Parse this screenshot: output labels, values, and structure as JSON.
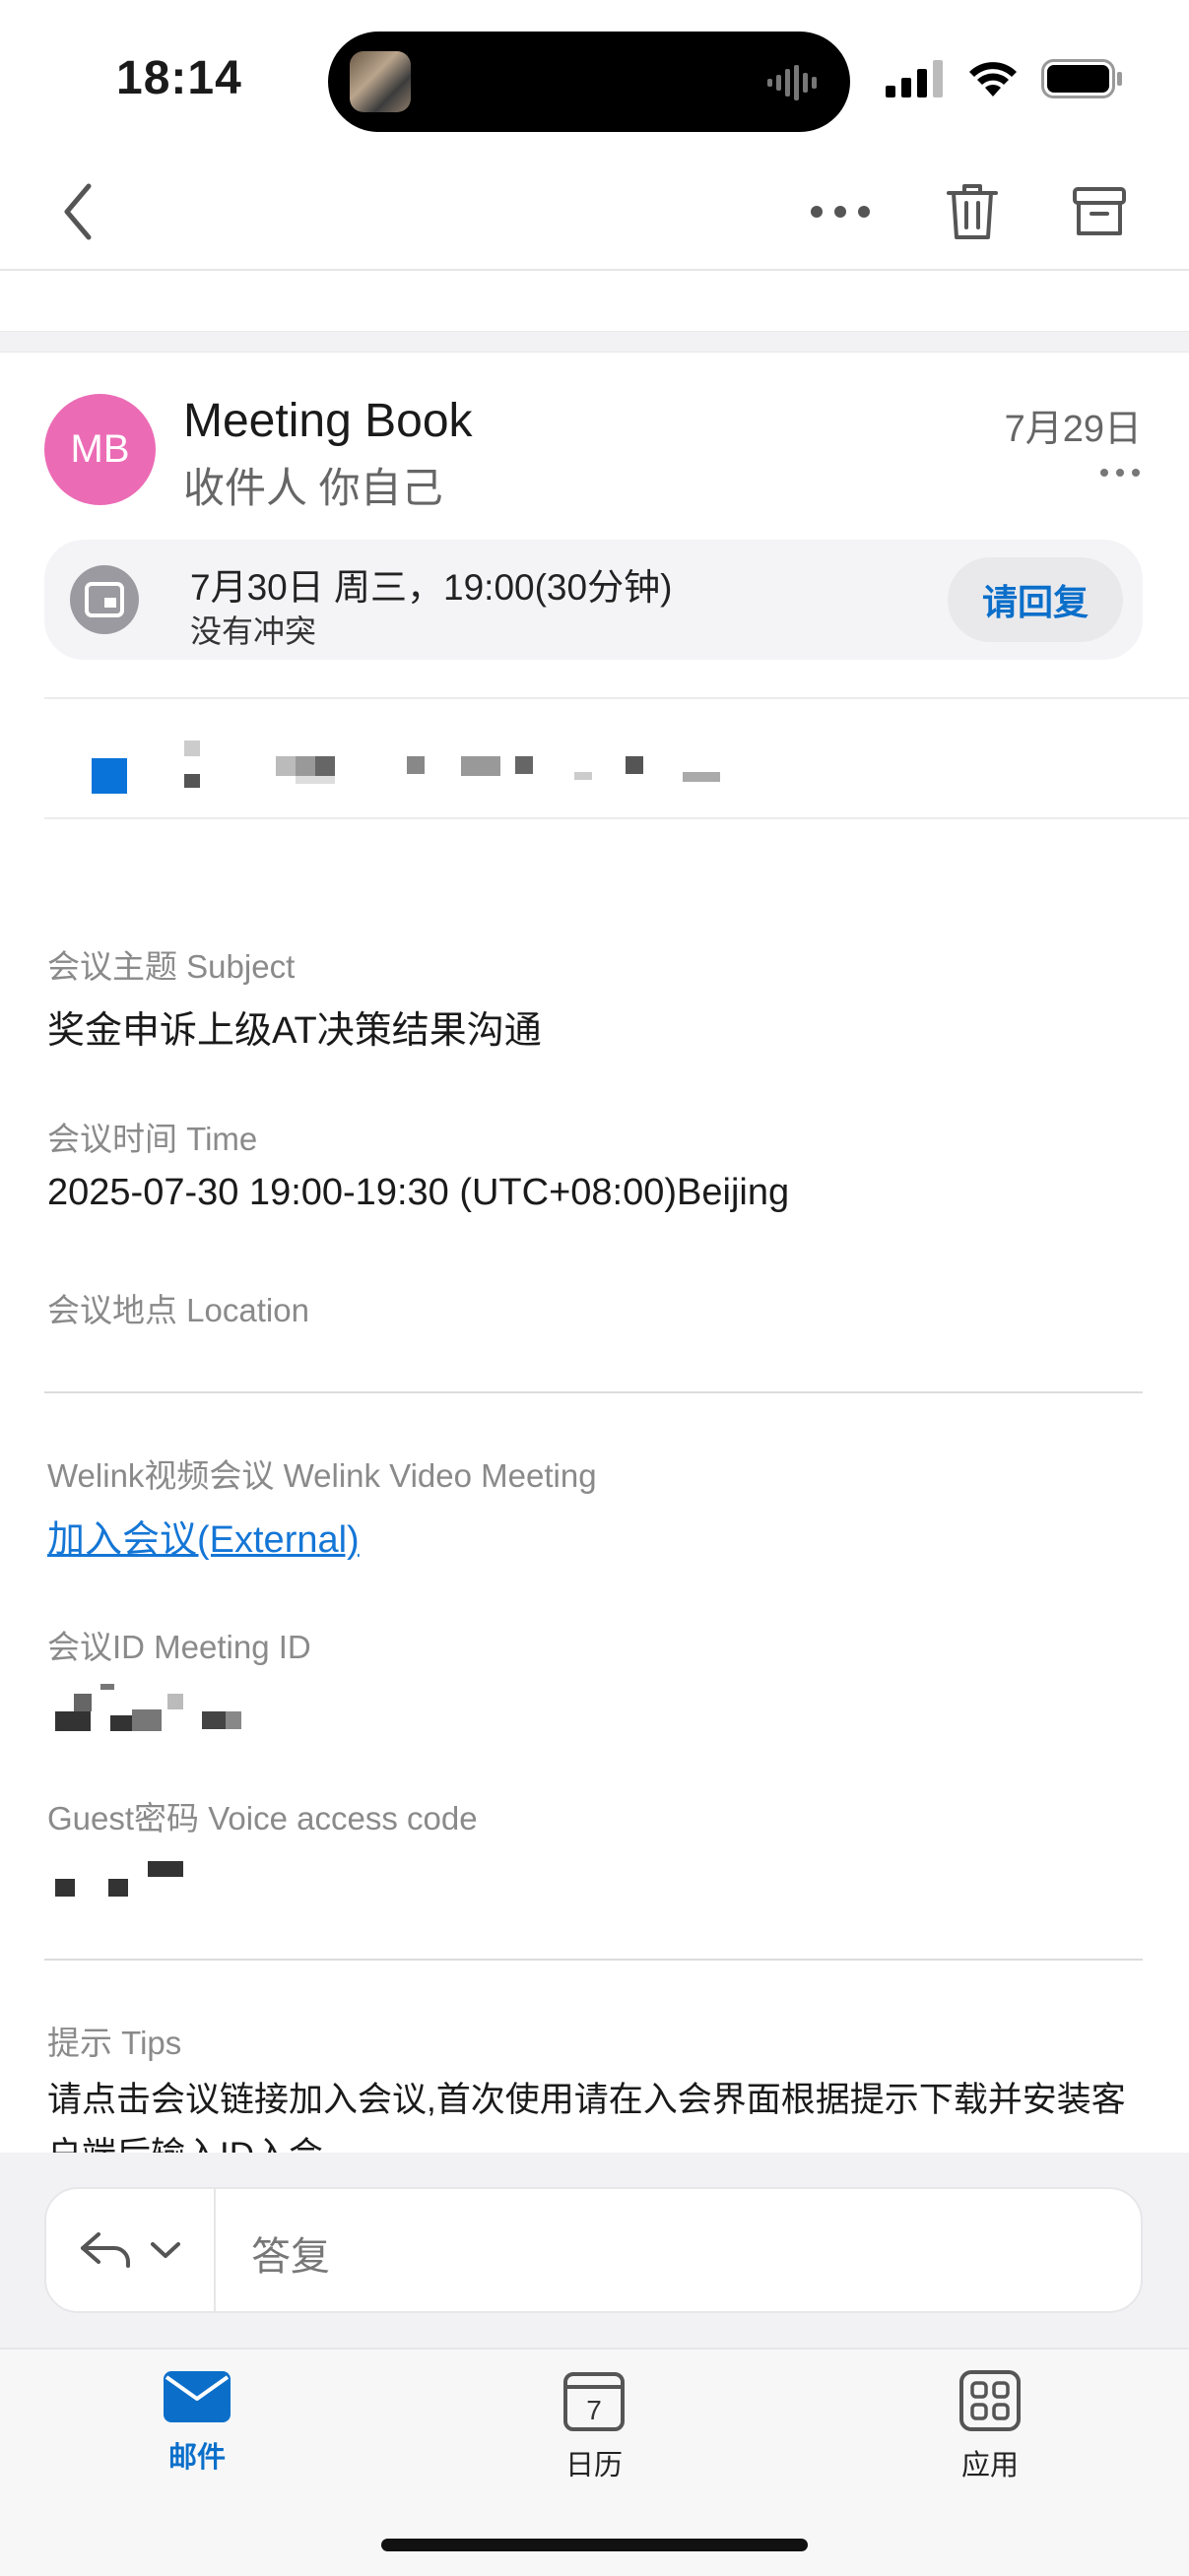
{
  "status_bar": {
    "time": "18:14"
  },
  "email": {
    "avatar_initials": "MB",
    "sender": "Meeting Book",
    "recipients": "收件人 你自己",
    "date": "7月29日",
    "invite": {
      "time": "7月30日 周三，19:00(30分钟)",
      "conflict": "没有冲突",
      "reply_label": "请回复"
    },
    "body": {
      "subject_label": "会议主题 Subject",
      "subject_value": "奖金申诉上级AT决策结果沟通",
      "time_label": "会议时间 Time",
      "time_value": "2025-07-30 19:00-19:30 (UTC+08:00)Beijing",
      "location_label": "会议地点 Location",
      "video_label": "Welink视频会议 Welink Video Meeting",
      "join_link": "加入会议(External)",
      "meeting_id_label": "会议ID Meeting ID",
      "guest_code_label": "Guest密码 Voice access code",
      "tips_label": "提示 Tips",
      "tips_text": "请点击会议链接加入会议,首次使用请在入会界面根据提示下载并安装客户端后输入ID入会"
    }
  },
  "reply_bar": {
    "placeholder": "答复"
  },
  "tabbar": {
    "tabs": [
      {
        "label": "邮件",
        "active": true
      },
      {
        "label": "日历",
        "calendar_day": "7"
      },
      {
        "label": "应用"
      }
    ]
  },
  "colors": {
    "accent": "#0b6fca",
    "avatar": "#ec6bb5",
    "link": "#1476d6"
  }
}
